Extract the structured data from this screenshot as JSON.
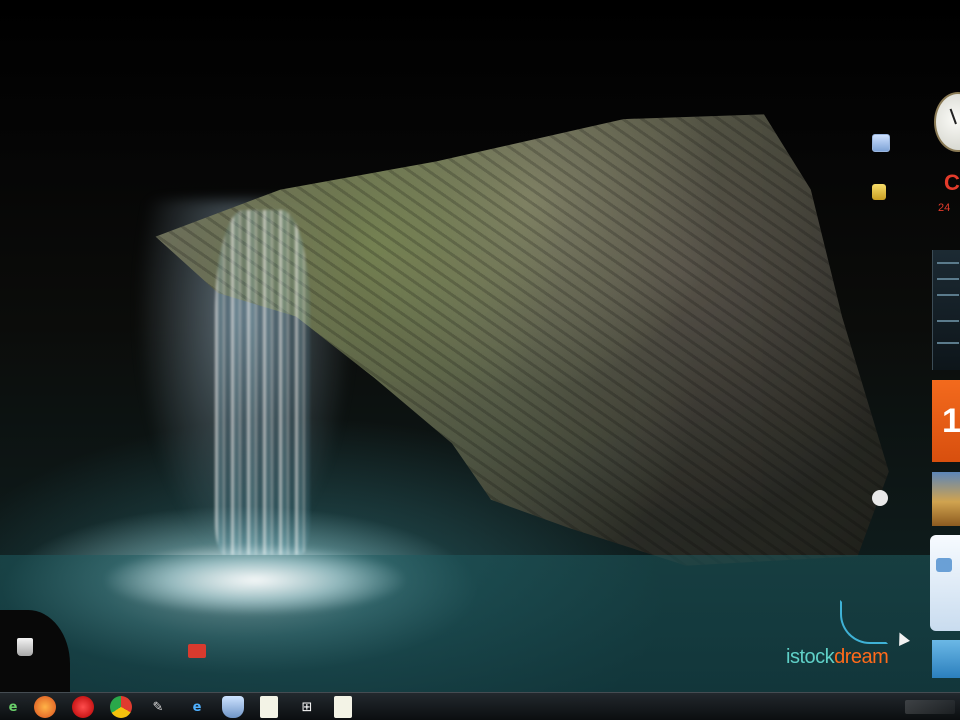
{
  "gadgets": {
    "calendar_letter": "C",
    "calendar_day": "24",
    "orange_tile_number": "1"
  },
  "watermark": {
    "part1": "istock",
    "part2": "dream"
  },
  "taskbar": {
    "start_glyph": "e",
    "ie_glyph": "e",
    "feather_glyph": "✎",
    "windows_glyph": "⊞"
  },
  "colors": {
    "watermark_primary": "#5fd0c7",
    "watermark_accent": "#ff6a1a",
    "taskbar": "#1a1e22",
    "pool": "#1e5a5f"
  }
}
